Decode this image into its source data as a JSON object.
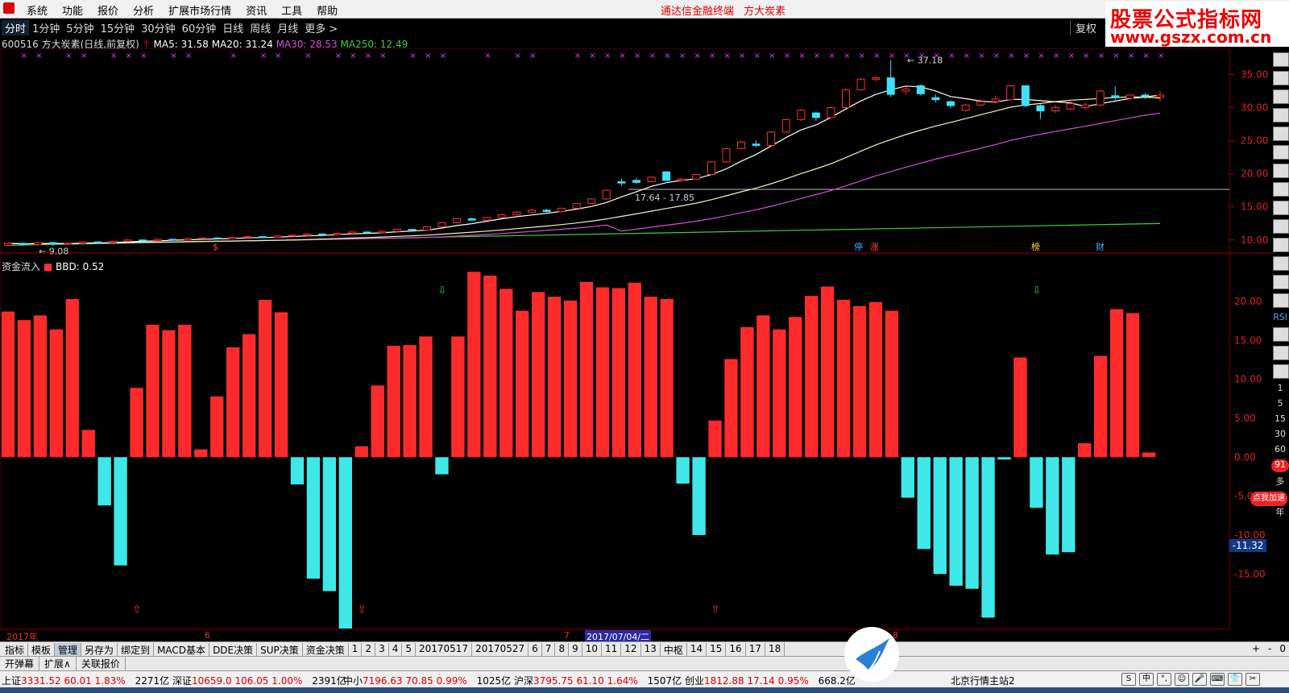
{
  "menubar": {
    "items": [
      "系统",
      "功能",
      "报价",
      "分析",
      "扩展市场行情",
      "资讯",
      "工具",
      "帮助"
    ],
    "center_title": "通达信金融终端",
    "stock_title": "方大炭素"
  },
  "watermark": {
    "line1": "股票公式指标网",
    "line2": "www.gszx.com.cn"
  },
  "periodbar": {
    "periods": [
      "分时",
      "1分钟",
      "5分钟",
      "15分钟",
      "30分钟",
      "60分钟",
      "日线",
      "周线",
      "月线",
      "更多 >"
    ],
    "active_index": 0,
    "fuquan": "复权"
  },
  "info": {
    "stock": "600516 方大炭素(日线,前复权)",
    "ma5": "MA5: 31.58",
    "ma20": "MA20: 31.24",
    "ma30": "MA30: 28.53",
    "ma250": "MA250: 12.49"
  },
  "sub": {
    "name": "资金流入",
    "bbd": "BBD: 0.52"
  },
  "chart_data": [
    {
      "type": "candlestick",
      "title": "",
      "ylim": [
        9,
        37.5
      ],
      "ylabels": [
        "35.00",
        "30.00",
        "25.00",
        "20.00",
        "15.00",
        "10.00"
      ],
      "yticks": [
        35,
        30,
        25,
        20,
        15,
        10
      ],
      "annotations": {
        "high": "37.18",
        "range": "17.64 - 17.85",
        "low": "9.08"
      },
      "event_markers": [
        "停",
        "涨",
        "榜",
        "财",
        "$"
      ],
      "candles": [
        {
          "o": 9.2,
          "c": 9.5,
          "h": 9.6,
          "l": 9.0
        },
        {
          "o": 9.5,
          "c": 9.3,
          "h": 9.6,
          "l": 9.1
        },
        {
          "o": 9.3,
          "c": 9.6,
          "h": 9.7,
          "l": 9.2
        },
        {
          "o": 9.6,
          "c": 9.4,
          "h": 9.7,
          "l": 9.08
        },
        {
          "o": 9.4,
          "c": 9.5,
          "h": 9.6,
          "l": 9.3
        },
        {
          "o": 9.5,
          "c": 9.7,
          "h": 9.8,
          "l": 9.4
        },
        {
          "o": 9.7,
          "c": 9.6,
          "h": 9.8,
          "l": 9.5
        },
        {
          "o": 9.6,
          "c": 9.8,
          "h": 9.9,
          "l": 9.5
        },
        {
          "o": 9.8,
          "c": 10.0,
          "h": 10.1,
          "l": 9.7
        },
        {
          "o": 10.0,
          "c": 9.9,
          "h": 10.1,
          "l": 9.8
        },
        {
          "o": 9.9,
          "c": 10.1,
          "h": 10.2,
          "l": 9.8
        },
        {
          "o": 10.1,
          "c": 10.0,
          "h": 10.2,
          "l": 9.9
        },
        {
          "o": 10.0,
          "c": 10.2,
          "h": 10.3,
          "l": 9.9
        },
        {
          "o": 10.2,
          "c": 10.3,
          "h": 10.4,
          "l": 10.1
        },
        {
          "o": 10.3,
          "c": 10.2,
          "h": 10.4,
          "l": 10.1
        },
        {
          "o": 10.2,
          "c": 10.4,
          "h": 10.5,
          "l": 10.1
        },
        {
          "o": 10.4,
          "c": 10.5,
          "h": 10.6,
          "l": 10.3
        },
        {
          "o": 10.5,
          "c": 10.4,
          "h": 10.6,
          "l": 10.3
        },
        {
          "o": 10.4,
          "c": 10.6,
          "h": 10.7,
          "l": 10.3
        },
        {
          "o": 10.6,
          "c": 10.7,
          "h": 10.8,
          "l": 10.5
        },
        {
          "o": 10.7,
          "c": 10.9,
          "h": 11.0,
          "l": 10.6
        },
        {
          "o": 10.9,
          "c": 10.8,
          "h": 11.0,
          "l": 10.7
        },
        {
          "o": 10.8,
          "c": 11.0,
          "h": 11.1,
          "l": 10.7
        },
        {
          "o": 11.0,
          "c": 11.2,
          "h": 11.3,
          "l": 10.9
        },
        {
          "o": 11.2,
          "c": 11.1,
          "h": 11.3,
          "l": 11.0
        },
        {
          "o": 11.1,
          "c": 11.3,
          "h": 11.4,
          "l": 11.0
        },
        {
          "o": 11.3,
          "c": 11.6,
          "h": 11.7,
          "l": 11.2
        },
        {
          "o": 11.6,
          "c": 11.5,
          "h": 11.7,
          "l": 11.4
        },
        {
          "o": 11.5,
          "c": 12.0,
          "h": 12.1,
          "l": 11.4
        },
        {
          "o": 12.0,
          "c": 12.6,
          "h": 12.7,
          "l": 11.9
        },
        {
          "o": 12.6,
          "c": 13.2,
          "h": 13.3,
          "l": 12.5
        },
        {
          "o": 13.2,
          "c": 13.0,
          "h": 13.4,
          "l": 12.9
        },
        {
          "o": 13.0,
          "c": 13.4,
          "h": 13.5,
          "l": 12.9
        },
        {
          "o": 13.4,
          "c": 13.8,
          "h": 13.9,
          "l": 13.3
        },
        {
          "o": 13.8,
          "c": 14.2,
          "h": 14.3,
          "l": 13.7
        },
        {
          "o": 14.2,
          "c": 14.5,
          "h": 14.7,
          "l": 14.1
        },
        {
          "o": 14.5,
          "c": 14.3,
          "h": 14.7,
          "l": 14.2
        },
        {
          "o": 14.3,
          "c": 14.8,
          "h": 14.9,
          "l": 14.2
        },
        {
          "o": 14.8,
          "c": 15.5,
          "h": 15.6,
          "l": 14.7
        },
        {
          "o": 15.5,
          "c": 16.2,
          "h": 16.3,
          "l": 15.4
        },
        {
          "o": 16.2,
          "c": 17.5,
          "h": 17.6,
          "l": 16.1
        },
        {
          "o": 18.8,
          "c": 18.6,
          "h": 19.3,
          "l": 18.2
        },
        {
          "o": 19.0,
          "c": 18.7,
          "h": 19.4,
          "l": 18.5
        },
        {
          "o": 18.8,
          "c": 19.5,
          "h": 19.6,
          "l": 18.7
        },
        {
          "o": 20.3,
          "c": 19.0,
          "h": 20.4,
          "l": 18.9
        },
        {
          "o": 19.0,
          "c": 19.2,
          "h": 19.4,
          "l": 18.8
        },
        {
          "o": 19.2,
          "c": 19.9,
          "h": 20.0,
          "l": 19.1
        },
        {
          "o": 19.9,
          "c": 21.8,
          "h": 21.9,
          "l": 19.8
        },
        {
          "o": 21.8,
          "c": 23.8,
          "h": 23.9,
          "l": 21.7
        },
        {
          "o": 23.8,
          "c": 24.8,
          "h": 25.0,
          "l": 23.7
        },
        {
          "o": 24.5,
          "c": 24.3,
          "h": 25.0,
          "l": 24.0
        },
        {
          "o": 24.3,
          "c": 26.3,
          "h": 26.5,
          "l": 24.2
        },
        {
          "o": 26.3,
          "c": 28.2,
          "h": 28.4,
          "l": 26.2
        },
        {
          "o": 28.2,
          "c": 29.6,
          "h": 29.8,
          "l": 28.0
        },
        {
          "o": 29.2,
          "c": 28.5,
          "h": 29.4,
          "l": 28.0
        },
        {
          "o": 28.5,
          "c": 30.0,
          "h": 30.2,
          "l": 28.4
        },
        {
          "o": 30.0,
          "c": 32.7,
          "h": 32.9,
          "l": 29.9
        },
        {
          "o": 32.7,
          "c": 34.3,
          "h": 34.5,
          "l": 32.6
        },
        {
          "o": 34.3,
          "c": 34.5,
          "h": 34.7,
          "l": 33.9
        },
        {
          "o": 34.5,
          "c": 32.0,
          "h": 37.18,
          "l": 31.6
        },
        {
          "o": 32.5,
          "c": 32.8,
          "h": 33.2,
          "l": 32.0
        },
        {
          "o": 33.3,
          "c": 32.1,
          "h": 33.5,
          "l": 31.8
        },
        {
          "o": 31.5,
          "c": 31.2,
          "h": 32.0,
          "l": 30.8
        },
        {
          "o": 30.9,
          "c": 30.3,
          "h": 31.1,
          "l": 29.9
        },
        {
          "o": 29.6,
          "c": 30.4,
          "h": 30.6,
          "l": 29.4
        },
        {
          "o": 30.4,
          "c": 30.9,
          "h": 31.3,
          "l": 30.2
        },
        {
          "o": 30.9,
          "c": 31.3,
          "h": 31.8,
          "l": 30.6
        },
        {
          "o": 31.2,
          "c": 33.3,
          "h": 33.5,
          "l": 31.0
        },
        {
          "o": 33.3,
          "c": 30.3,
          "h": 33.4,
          "l": 30.0
        },
        {
          "o": 30.3,
          "c": 29.5,
          "h": 30.5,
          "l": 28.3
        },
        {
          "o": 29.5,
          "c": 30.0,
          "h": 30.4,
          "l": 29.2
        },
        {
          "o": 29.8,
          "c": 30.6,
          "h": 31.0,
          "l": 29.6
        },
        {
          "o": 30.0,
          "c": 30.4,
          "h": 30.8,
          "l": 29.7
        },
        {
          "o": 30.4,
          "c": 32.5,
          "h": 32.7,
          "l": 30.2
        },
        {
          "o": 31.8,
          "c": 31.5,
          "h": 33.2,
          "l": 31.2
        },
        {
          "o": 31.4,
          "c": 31.9,
          "h": 32.1,
          "l": 31.1
        },
        {
          "o": 31.9,
          "c": 31.7,
          "h": 32.2,
          "l": 31.3
        },
        {
          "o": 31.6,
          "c": 31.9,
          "h": 32.6,
          "l": 30.9
        }
      ],
      "ma": [
        {
          "name": "MA5",
          "color": "#ffffff"
        },
        {
          "name": "MA20",
          "color": "#f3f3b0"
        },
        {
          "name": "MA30",
          "color": "#d24fd8"
        },
        {
          "name": "MA250",
          "color": "#3fcf3f"
        }
      ],
      "ma250": [
        9.2,
        12.49
      ]
    },
    {
      "type": "bar",
      "title": "资金流入",
      "ylim": [
        -22,
        26
      ],
      "ylabels": [
        "20.00",
        "15.00",
        "10.00",
        "5.00",
        "0.00",
        "-5.00",
        "-10.00",
        "-15.00"
      ],
      "yticks": [
        20,
        15,
        10,
        5,
        0,
        -5,
        -10,
        -15
      ],
      "current_value": "-11.32",
      "values": [
        18.7,
        17.6,
        18.2,
        16.4,
        20.3,
        3.5,
        -6.2,
        -13.9,
        8.9,
        17.0,
        16.3,
        17.0,
        1.0,
        7.8,
        14.1,
        15.8,
        20.2,
        18.6,
        -3.5,
        -15.6,
        -17.2,
        -22.0,
        1.4,
        9.2,
        14.3,
        14.4,
        15.5,
        -2.2,
        15.5,
        23.8,
        23.3,
        21.6,
        18.8,
        21.2,
        20.6,
        20.1,
        22.5,
        21.8,
        21.7,
        22.4,
        20.6,
        20.3,
        -3.4,
        -10.0,
        4.7,
        12.6,
        16.7,
        18.2,
        16.4,
        18.0,
        20.7,
        21.9,
        20.2,
        19.4,
        19.9,
        18.8,
        -5.2,
        -11.8,
        -15.0,
        -16.5,
        -16.9,
        -20.6,
        -0.3,
        12.8,
        -6.5,
        -12.5,
        -12.2,
        1.8,
        13.0,
        19.0,
        18.5,
        0.6
      ],
      "up_arrows": [
        8,
        22,
        44
      ],
      "down_arrows": [
        27,
        64
      ]
    }
  ],
  "datebar": {
    "year": "2017年",
    "month6": "6",
    "month7": "7",
    "current": "2017/07/04/二",
    "month8": "8"
  },
  "tabbar": {
    "tabs": [
      "指标",
      "模板",
      "管理",
      "另存为",
      "绑定到",
      "MACD基本",
      "DDE决策",
      "SUP决策",
      "资金决策",
      "1",
      "2",
      "3",
      "4",
      "5",
      "20170517",
      "20170527",
      "6",
      "7",
      "8",
      "9",
      "10",
      "11",
      "12",
      "13",
      "中枢",
      "14",
      "15",
      "16",
      "17",
      "18"
    ],
    "active_index": 2,
    "right": [
      "+",
      "-",
      "0"
    ]
  },
  "subtabbar": {
    "items": [
      "开弹幕",
      "扩展∧",
      "关联报价"
    ]
  },
  "statusbar": {
    "items": [
      {
        "label": "上证",
        "val": "3331.52",
        "chg": "60.01",
        "pct": "1.83%",
        "amt": "2271亿"
      },
      {
        "label": "深证",
        "val": "10659.0",
        "chg": "106.05",
        "pct": "1.00%",
        "amt": "2391亿"
      },
      {
        "label": "中小",
        "val": "7196.63",
        "chg": "70.85",
        "pct": "0.99%",
        "amt": "1025亿"
      },
      {
        "label": "沪深",
        "val": "3795.75",
        "chg": "61.10",
        "pct": "1.64%",
        "amt": "1507亿"
      },
      {
        "label": "创业",
        "val": "1812.88",
        "chg": "17.14",
        "pct": "0.95%",
        "amt": "668.2亿"
      }
    ],
    "server": "北京行情主站2",
    "tray": [
      "S",
      "中",
      "°,",
      "☺",
      "🎤",
      "⌨",
      "👕",
      "✂"
    ]
  },
  "right_toolbar": {
    "numbers": [
      "1",
      "5",
      "15",
      "30",
      "60"
    ],
    "words": [
      "多",
      "季",
      "年"
    ],
    "rsi": "RSI",
    "promo": "点我加速",
    "badge": "91"
  },
  "colors": {
    "up": "#ff2b2b",
    "down": "#3fe8e8",
    "grid": "#7a0000",
    "ma5": "#ffffff",
    "ma20": "#f3f3b0",
    "ma30": "#d24fd8",
    "ma250": "#3fcf3f"
  }
}
